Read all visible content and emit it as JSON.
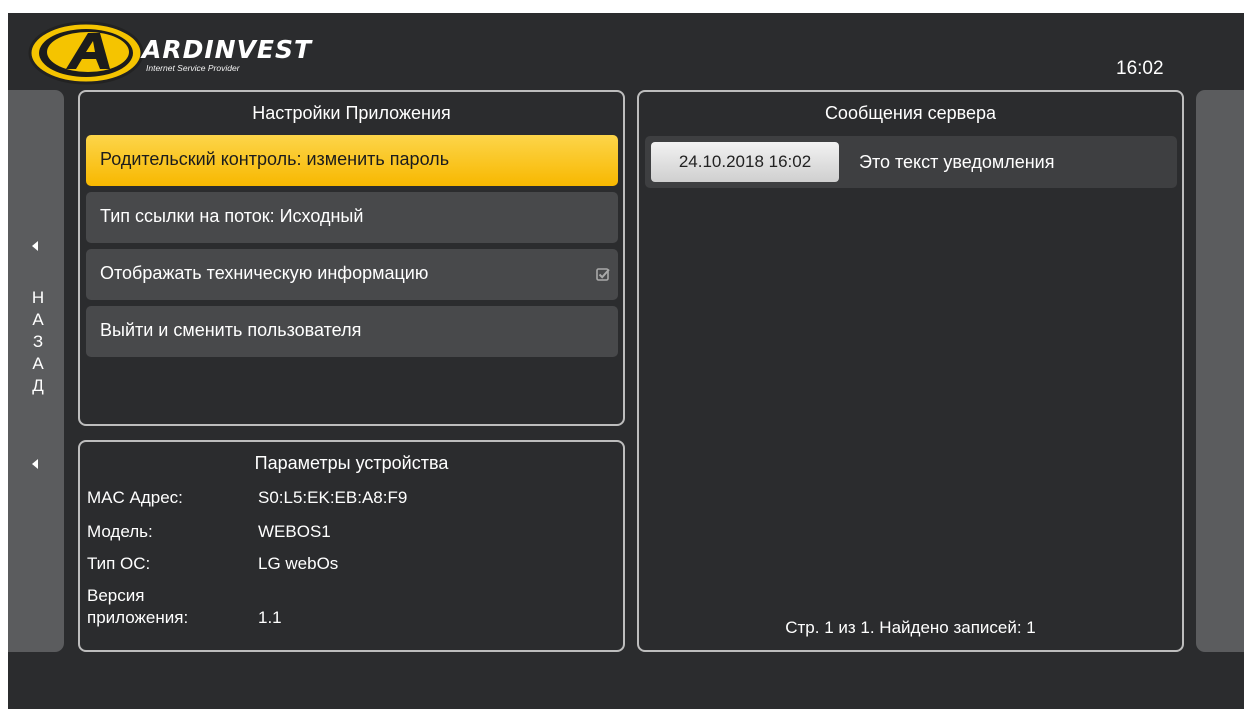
{
  "header": {
    "brand_name": "ARDINVEST",
    "brand_subtitle": "Internet Service Provider",
    "clock": "16:02"
  },
  "nav": {
    "back_letters": [
      "Н",
      "А",
      "З",
      "А",
      "Д"
    ]
  },
  "settings": {
    "title": "Настройки Приложения",
    "items": [
      {
        "label": "Родительский контроль: изменить пароль",
        "active": true
      },
      {
        "label": "Тип ссылки на поток: Исходный",
        "active": false
      },
      {
        "label": "Отображать техническую информацию",
        "active": false,
        "checked": true
      },
      {
        "label": "Выйти и сменить пользователя",
        "active": false
      }
    ]
  },
  "device": {
    "title": "Параметры устройства",
    "rows": [
      {
        "label": "MAC Адрес:",
        "value": "S0:L5:EK:EB:A8:F9"
      },
      {
        "label": "Модель:",
        "value": "WEBOS1"
      },
      {
        "label": "Тип ОС:",
        "value": "LG webOs"
      },
      {
        "label_line1": "Версия",
        "label_line2": "приложения:",
        "value": "1.1"
      }
    ]
  },
  "messages": {
    "title": "Сообщения сервера",
    "items": [
      {
        "date": "24.10.2018 16:02",
        "text": "Это текст уведомления"
      }
    ],
    "pager": "Стр. 1 из 1. Найдено записей: 1"
  },
  "colors": {
    "background": "#2b2c2e",
    "accent": "#f8b800",
    "item": "#48494b",
    "side": "#5b5c5e",
    "border": "#bdbdbd"
  }
}
